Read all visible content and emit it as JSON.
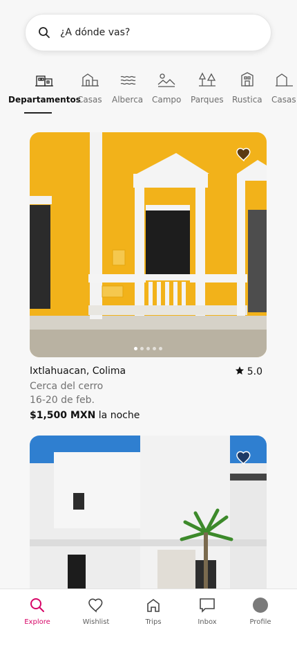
{
  "search": {
    "placeholder": "¿A dónde vas?"
  },
  "categories": [
    {
      "label": "Departamentos",
      "icon": "apartment-icon",
      "active": true
    },
    {
      "label": "Casas",
      "icon": "house-icon"
    },
    {
      "label": "Alberca",
      "icon": "pool-icon"
    },
    {
      "label": "Campo",
      "icon": "countryside-icon"
    },
    {
      "label": "Parques",
      "icon": "park-icon"
    },
    {
      "label": "Rustica",
      "icon": "rustic-icon"
    },
    {
      "label": "Casas",
      "icon": "house-icon"
    }
  ],
  "listings": [
    {
      "title": "Ixtlahuacan, Colima",
      "rating": "5.0",
      "subtitle": "Cerca del cerro",
      "dates": "16-20 de feb.",
      "price": "$1,500 MXN",
      "price_suffix": "la noche"
    }
  ],
  "tabs": [
    {
      "label": "Explore",
      "icon": "search-icon",
      "active": true
    },
    {
      "label": "Wishlist",
      "icon": "heart-icon"
    },
    {
      "label": "Trips",
      "icon": "home-icon"
    },
    {
      "label": "Inbox",
      "icon": "message-icon"
    },
    {
      "label": "Profile",
      "icon": "avatar"
    }
  ],
  "colors": {
    "accent": "#d70466",
    "facade_yellow": "#f2b21a"
  }
}
